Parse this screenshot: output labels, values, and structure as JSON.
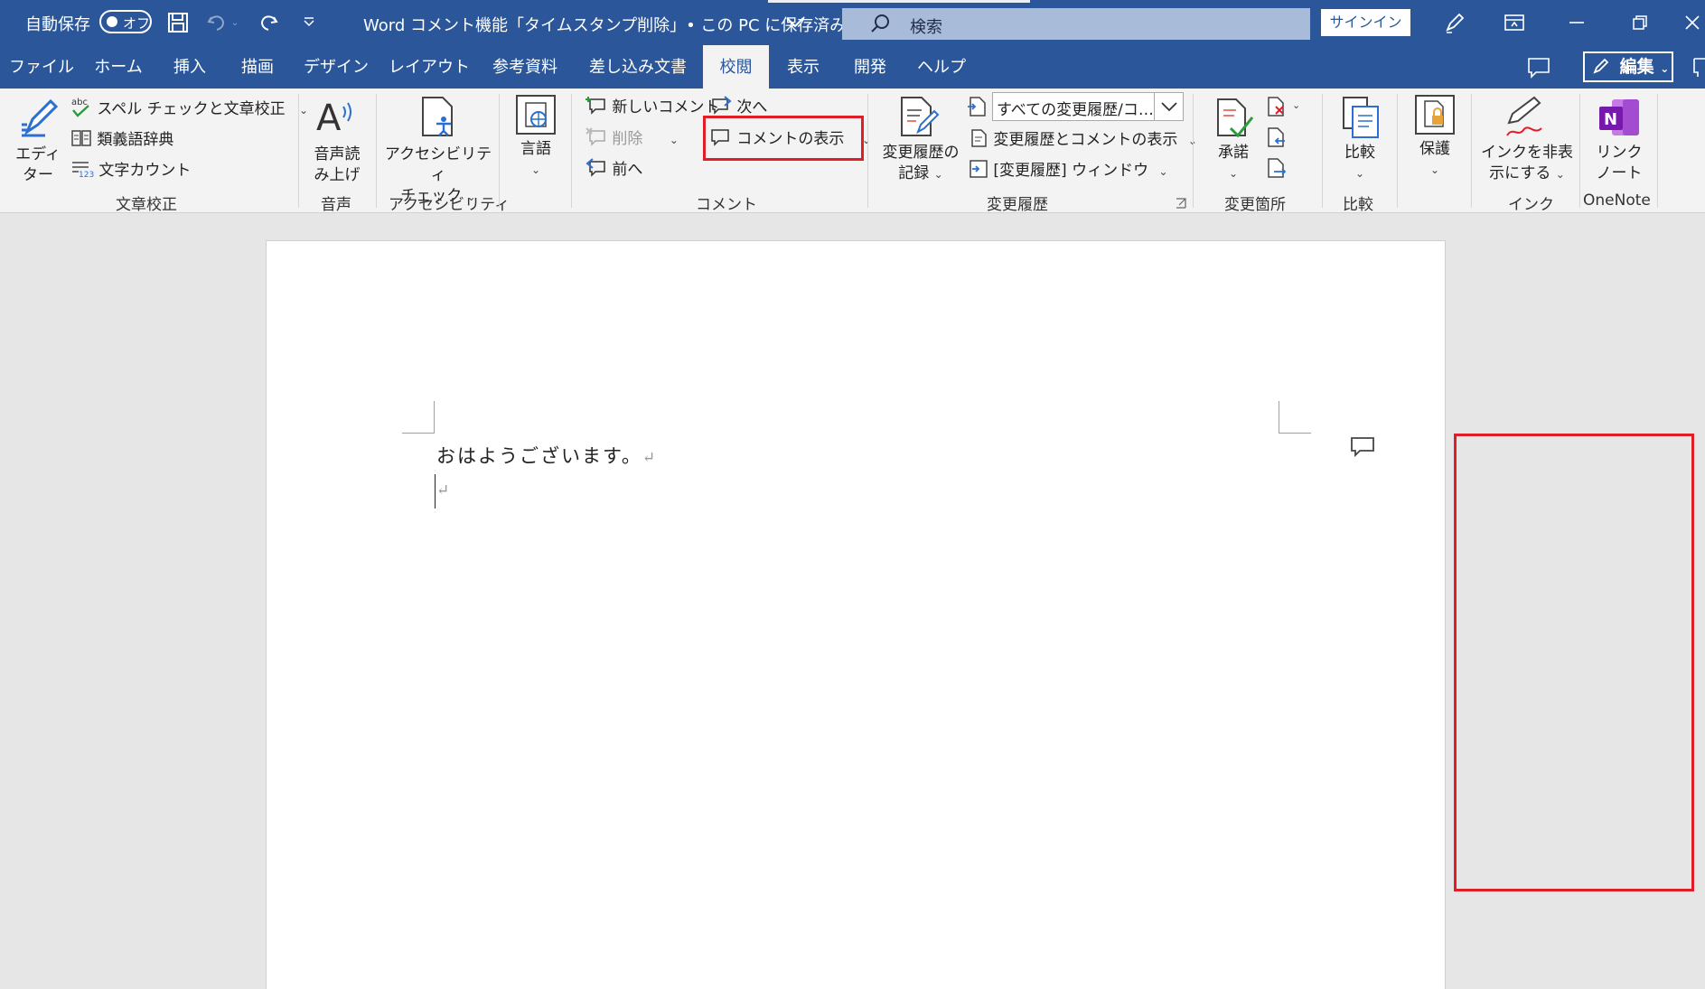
{
  "title_bar": {
    "autosave_label": "自動保存",
    "autosave_state": "オフ",
    "doc_title": "Word コメント機能「タイムスタンプ削除」• この PC に保存済み",
    "search_placeholder": "検索",
    "signin_label": "サインイン"
  },
  "tabs": [
    {
      "label": "ファイル"
    },
    {
      "label": "ホーム"
    },
    {
      "label": "挿入"
    },
    {
      "label": "描画"
    },
    {
      "label": "デザイン"
    },
    {
      "label": "レイアウト"
    },
    {
      "label": "参考資料"
    },
    {
      "label": "差し込み文書"
    },
    {
      "label": "校閲",
      "active": true
    },
    {
      "label": "表示"
    },
    {
      "label": "開発"
    },
    {
      "label": "ヘルプ"
    }
  ],
  "edit_button": "編集",
  "ribbon": {
    "proofing": {
      "editor_line1": "エディ",
      "editor_line2": "ター",
      "spell_check": "スペル チェックと文章校正",
      "thesaurus": "類義語辞典",
      "word_count": "文字カウント",
      "group": "文章校正"
    },
    "speech": {
      "line1": "音声読",
      "line2": "み上げ",
      "group": "音声"
    },
    "accessibility": {
      "line1": "アクセシビリティ",
      "line2": "チェック",
      "group": "アクセシビリティ"
    },
    "language": {
      "label": "言語"
    },
    "comments": {
      "new_comment": "新しいコメント",
      "delete": "削除",
      "previous": "前へ",
      "next": "次へ",
      "show_comments": "コメントの表示",
      "group": "コメント"
    },
    "tracking": {
      "track_line1": "変更履歴の",
      "track_line2": "記録",
      "markup_dropdown": "すべての変更履歴/コ…",
      "show_markup": "変更履歴とコメントの表示",
      "reviewing_pane": "[変更履歴] ウィンドウ",
      "group": "変更履歴"
    },
    "changes": {
      "accept": "承諾",
      "group": "変更箇所"
    },
    "compare": {
      "label": "比較",
      "group": "比較"
    },
    "protect": {
      "label": "保護"
    },
    "ink": {
      "line1": "インクを非表",
      "line2": "示にする",
      "group": "インク"
    },
    "onenote": {
      "line1": "リンク",
      "line2": "ノート",
      "group": "OneNote"
    }
  },
  "document": {
    "line1": "おはようございます。"
  },
  "colors": {
    "title_bar": "#2b579a",
    "highlight": "#e01e2a",
    "ribbon": "#f3f3f3"
  }
}
